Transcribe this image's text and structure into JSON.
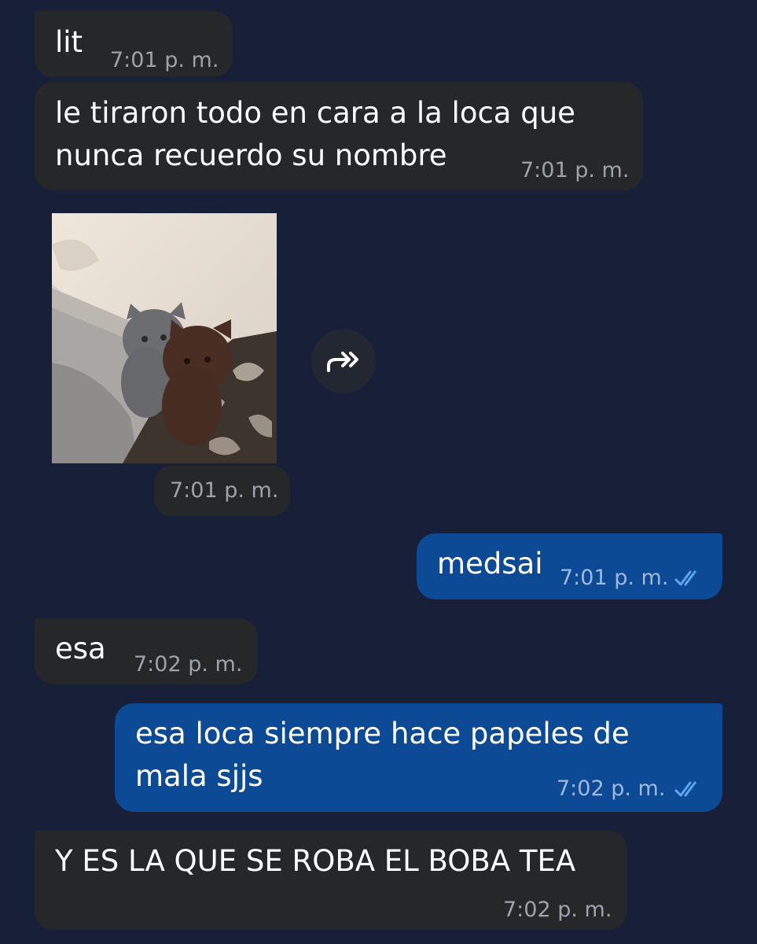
{
  "messages": [
    {
      "direction": "incoming",
      "text": "lit",
      "time": "7:01 p. m."
    },
    {
      "direction": "incoming",
      "text_lines": [
        "le tiraron todo en cara a la loca que",
        "nunca recuerdo su nombre"
      ],
      "time": "7:01 p. m."
    },
    {
      "direction": "incoming",
      "type": "photo",
      "time": "7:01 p. m."
    },
    {
      "direction": "outgoing",
      "text": "medsai",
      "time": "7:01 p. m.",
      "status": "read"
    },
    {
      "direction": "incoming",
      "text": "esa",
      "time": "7:02 p. m."
    },
    {
      "direction": "outgoing",
      "text_lines": [
        "esa loca siempre hace papeles de",
        "mala sjjs"
      ],
      "time": "7:02 p. m.",
      "status": "read"
    },
    {
      "direction": "incoming",
      "text": "Y ES LA QUE SE ROBA EL BOBA TEA",
      "time": "7:02 p. m."
    }
  ],
  "icons": {
    "forward": "forward-arrow-icon",
    "read": "double-check-icon"
  },
  "colors": {
    "background": "#182039",
    "incoming_bubble": "#252729",
    "outgoing_bubble": "#0c4a95",
    "read_check": "#5ea6f2"
  }
}
